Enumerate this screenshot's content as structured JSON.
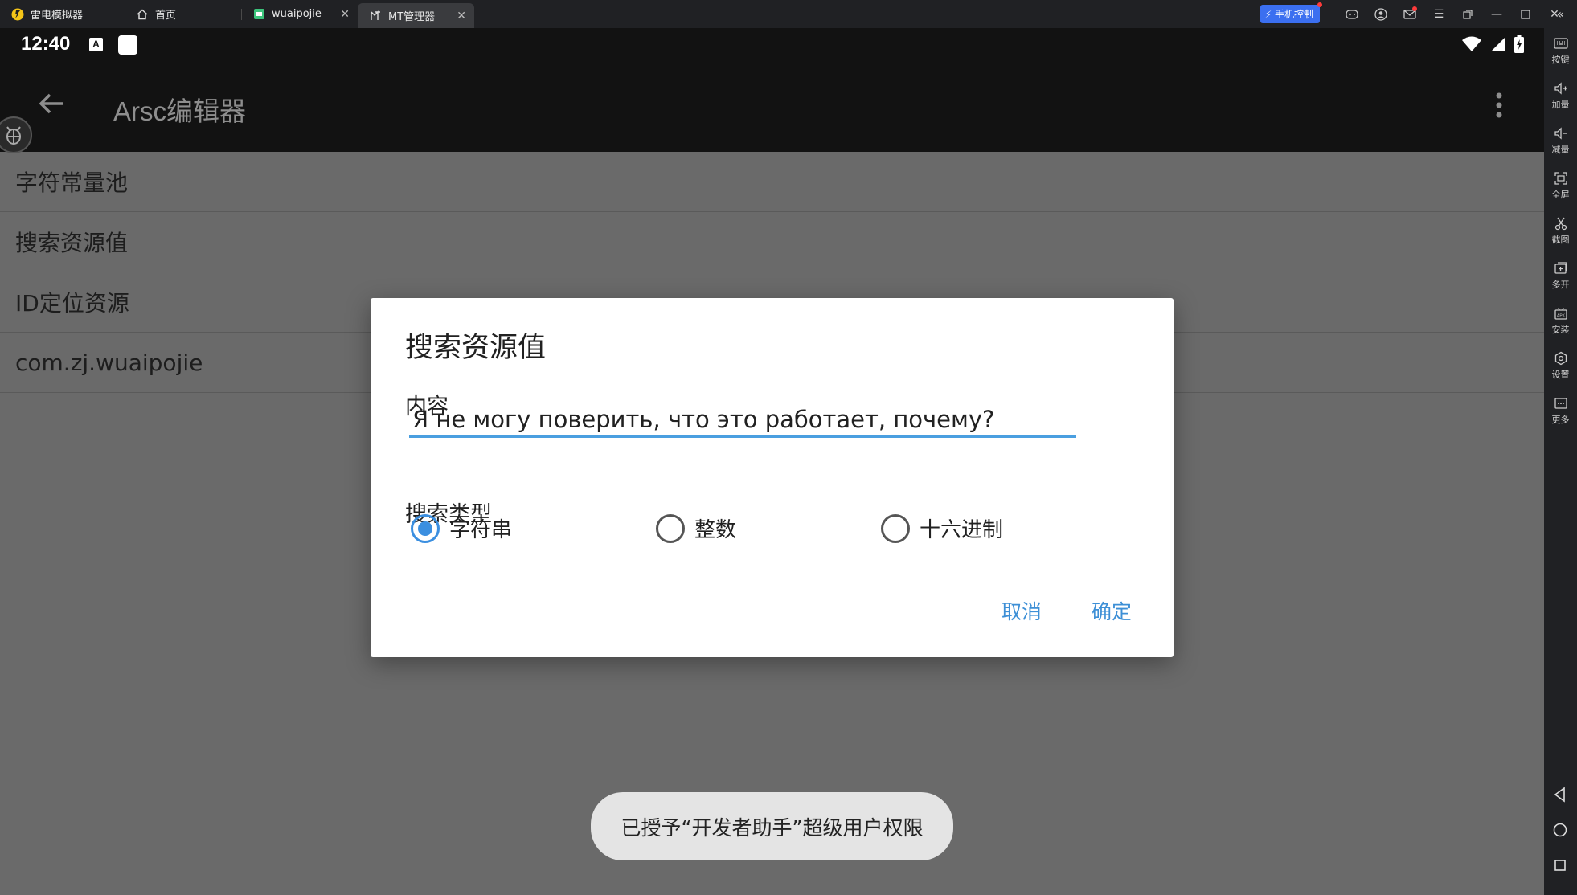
{
  "emulator": {
    "tabs": [
      {
        "label": "雷电模拟器"
      },
      {
        "label": "首页"
      },
      {
        "label": "wuaipojie"
      },
      {
        "label": "MT管理器"
      }
    ],
    "phone_control_label": "手机控制",
    "accent_color": "#3b6ff0"
  },
  "status_bar": {
    "time": "12:40",
    "keyboard_badge": "A"
  },
  "toolbar": {
    "title": "Arsc编辑器"
  },
  "list": [
    {
      "label": "字符常量池"
    },
    {
      "label": "搜索资源值"
    },
    {
      "label": "ID定位资源"
    },
    {
      "label": "com.zj.wuaipojie"
    }
  ],
  "dialog": {
    "title": "搜索资源值",
    "content_label": "内容",
    "content_value": "Я не могу поверить, что это работает, почему?",
    "type_label": "搜索类型",
    "options": [
      {
        "label": "字符串",
        "selected": true
      },
      {
        "label": "整数",
        "selected": false
      },
      {
        "label": "十六进制",
        "selected": false
      }
    ],
    "cancel_label": "取消",
    "ok_label": "确定",
    "accent_color": "#3b8fe0"
  },
  "toast": {
    "text": "已授予“开发者助手”超级用户权限"
  },
  "sidebar": [
    {
      "label": "按键",
      "icon": "keyboard-icon"
    },
    {
      "label": "加量",
      "icon": "volume-up-icon"
    },
    {
      "label": "减量",
      "icon": "volume-down-icon"
    },
    {
      "label": "全屏",
      "icon": "fullscreen-icon"
    },
    {
      "label": "截图",
      "icon": "scissors-icon"
    },
    {
      "label": "多开",
      "icon": "multi-open-icon"
    },
    {
      "label": "安装",
      "icon": "apk-install-icon"
    },
    {
      "label": "设置",
      "icon": "settings-icon"
    },
    {
      "label": "更多",
      "icon": "more-icon"
    }
  ]
}
